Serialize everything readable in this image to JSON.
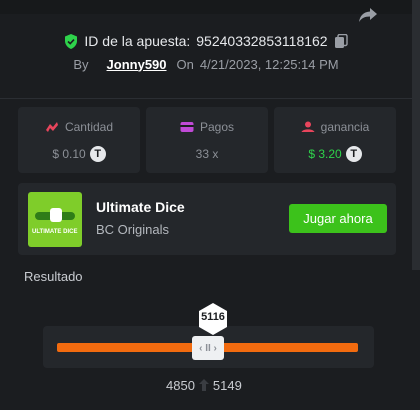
{
  "bet": {
    "id_label": "ID de la apuesta:",
    "id_value": "95240332853118162",
    "by_label": "By",
    "username": "Jonny590",
    "on_label": "On",
    "datetime": "4/21/2023, 12:25:14 PM"
  },
  "stats": {
    "amount": {
      "label": "Cantidad",
      "value": "$ 0.10",
      "currency_icon": "tether-icon"
    },
    "payout": {
      "label": "Pagos",
      "value": "33 x"
    },
    "profit": {
      "label": "ganancia",
      "value": "$ 3.20",
      "currency_icon": "tether-icon"
    }
  },
  "game": {
    "thumbnail_title": "ULTIMATE DICE",
    "thumbnail_badge": "roll",
    "name": "Ultimate Dice",
    "provider": "BC Originals",
    "play_label": "Jugar ahora"
  },
  "result": {
    "label": "Resultado",
    "value": "5116",
    "range_low": "4850",
    "range_high": "5149",
    "handle_glyph": "‹ II ›"
  },
  "colors": {
    "background": "#1b1d20",
    "card": "#24272b",
    "accent_green": "#3cc21b",
    "profit_green": "#2ed34b",
    "track_orange": "#f26b0f",
    "amount_icon": "#e8455c",
    "payout_icon": "#c04ad6",
    "profit_icon": "#e8455c",
    "shield": "#2ed34b"
  }
}
